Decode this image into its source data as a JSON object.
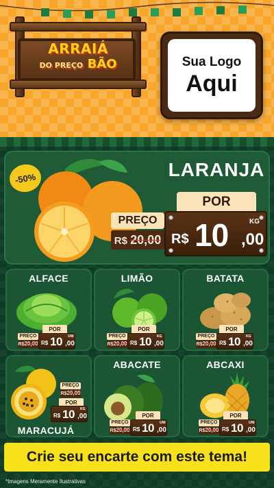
{
  "header": {
    "title_line1": "ARRAIÁ",
    "title_line2_small": "DO PREÇO",
    "title_line2": "BÃO",
    "logo_line1": "Sua Logo",
    "logo_line2": "Aqui"
  },
  "featured": {
    "discount": "-50%",
    "name": "LARANJA",
    "por_label": "POR",
    "preco_label": "PREÇO",
    "old_currency": "R$",
    "old_price": "20,00",
    "currency": "R$",
    "price_int": "10",
    "price_dec": ",00",
    "unit": "KG"
  },
  "products": [
    {
      "name": "ALFACE",
      "preco_label": "PREÇO",
      "old_currency": "R$",
      "old_price": "20,00",
      "por_label": "POR",
      "currency": "R$",
      "price_int": "10",
      "price_dec": ",00",
      "unit": "UNI"
    },
    {
      "name": "LIMÃO",
      "preco_label": "PREÇO",
      "old_currency": "R$",
      "old_price": "20,00",
      "por_label": "POR",
      "currency": "R$",
      "price_int": "10",
      "price_dec": ",00",
      "unit": "KG"
    },
    {
      "name": "BATATA",
      "preco_label": "PREÇO",
      "old_currency": "R$",
      "old_price": "20,00",
      "por_label": "POR",
      "currency": "R$",
      "price_int": "10",
      "price_dec": ",00",
      "unit": "KG"
    },
    {
      "name": "MARACUJÁ",
      "preco_label": "PREÇO",
      "old_currency": "R$",
      "old_price": "20,00",
      "por_label": "POR",
      "currency": "R$",
      "price_int": "10",
      "price_dec": ",00",
      "unit": "KG"
    },
    {
      "name": "ABACATE",
      "preco_label": "PREÇO",
      "old_currency": "R$",
      "old_price": "20,00",
      "por_label": "POR",
      "currency": "R$",
      "price_int": "10",
      "price_dec": ",00",
      "unit": "UNI"
    },
    {
      "name": "ABCAXI",
      "preco_label": "PREÇO",
      "old_currency": "R$",
      "old_price": "20,00",
      "por_label": "POR",
      "currency": "R$",
      "price_int": "10",
      "price_dec": ",00",
      "unit": "UNI"
    }
  ],
  "cta": "Crie seu encarte com este tema!",
  "disclaimer": "*Imagens Meramente Ilustrativas",
  "colors": {
    "header_orange": "#f7a62b",
    "body_green": "#0f3c24",
    "card_green": "#1b5533",
    "wood": "#4a2a12",
    "label_cream": "#fbe3b9",
    "cta_yellow": "#f7e11a",
    "title_yellow": "#ffd21a"
  },
  "icons": [
    "bunting-flags",
    "wooden-sign",
    "orange-fruit",
    "lettuce",
    "lime",
    "potato",
    "passion-fruit",
    "avocado",
    "pineapple"
  ]
}
